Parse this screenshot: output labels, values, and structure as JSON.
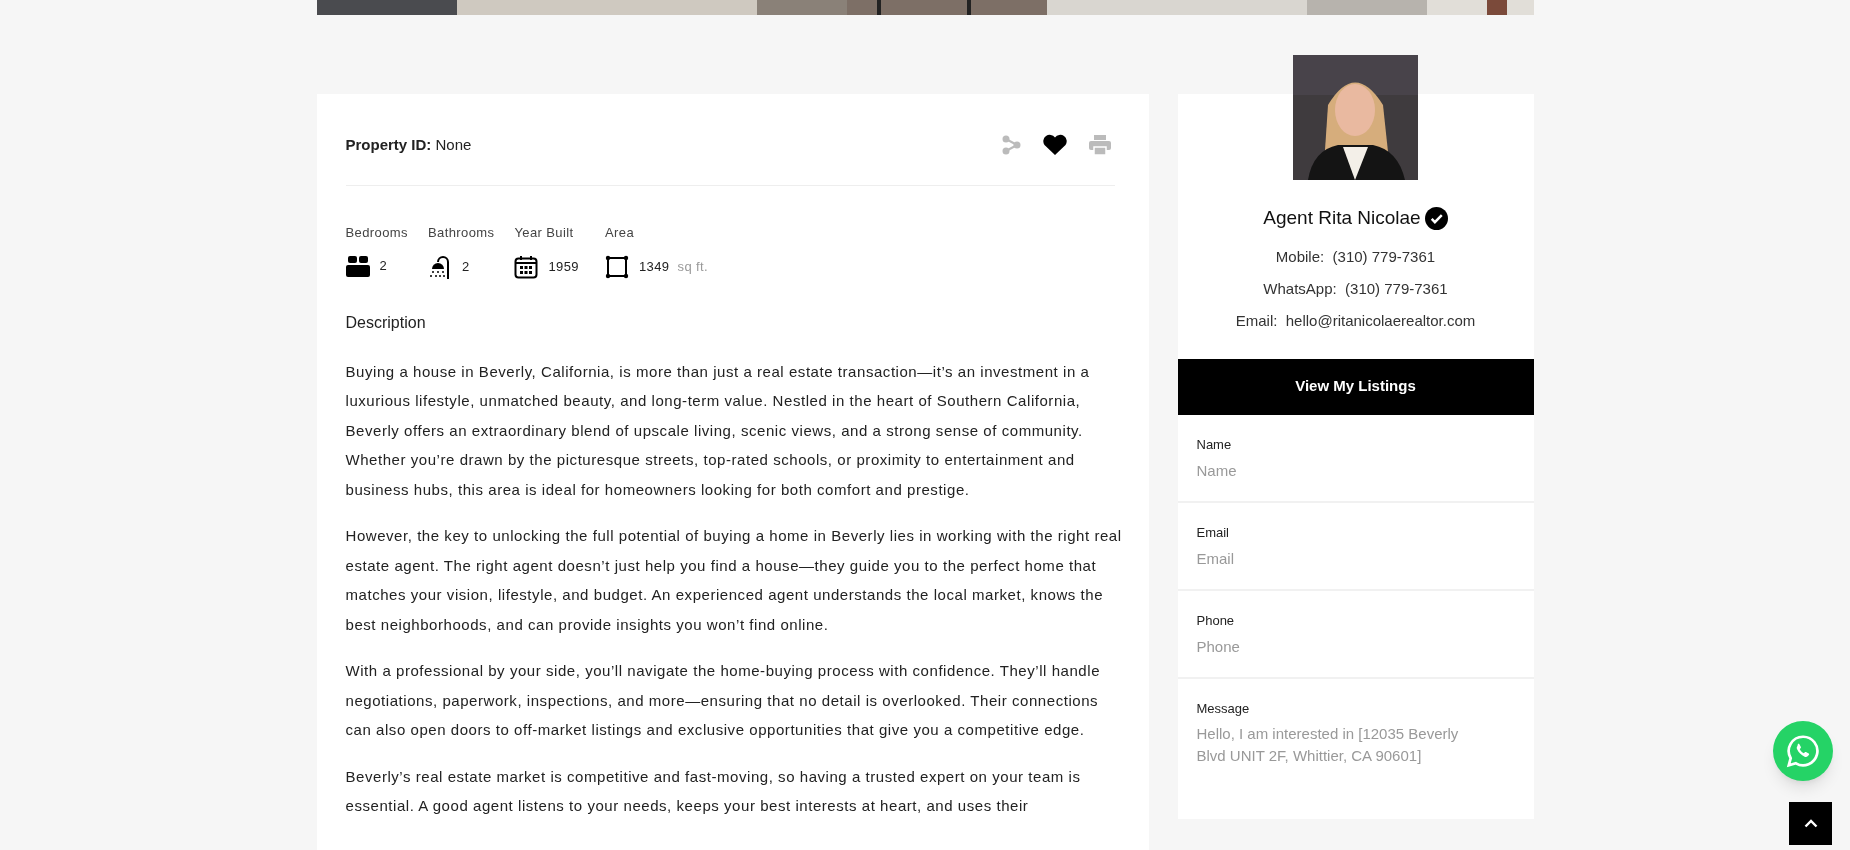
{
  "property": {
    "id_label": "Property ID:",
    "id_value": "None"
  },
  "actions": [
    {
      "kind": "share"
    },
    {
      "kind": "favorite"
    },
    {
      "kind": "print"
    }
  ],
  "facts": [
    {
      "kind": "bed",
      "label": "Bedrooms",
      "value": "2"
    },
    {
      "kind": "bath",
      "label": "Bathrooms",
      "value": "2"
    },
    {
      "kind": "year",
      "label": "Year Built",
      "value": "1959"
    },
    {
      "kind": "area",
      "label": "Area",
      "value": "1349",
      "unit": "sq ft."
    }
  ],
  "description": {
    "title": "Description",
    "paragraphs": [
      "Buying a house in Beverly, California, is more than just a real estate transaction—it’s an investment in a luxurious lifestyle, unmatched beauty, and long-term value. Nestled in the heart of Southern California, Beverly offers an extraordinary blend of upscale living, scenic views, and a strong sense of community. Whether you’re drawn by the picturesque streets, top-rated schools, or proximity to entertainment and business hubs, this area is ideal for homeowners looking for both comfort and prestige.",
      "However, the key to unlocking the full potential of buying a home in Beverly lies in working with the right real estate agent. The right agent doesn’t just help you find a house—they guide you to the perfect home that matches your vision, lifestyle, and budget. An experienced agent understands the local market, knows the best neighborhoods, and can provide insights you won’t find online.",
      "With a professional by your side, you’ll navigate the home-buying process with confidence. They’ll handle negotiations, paperwork, inspections, and more—ensuring that no detail is overlooked. Their connections can also open doors to off-market listings and exclusive opportunities that give you a competitive edge.",
      "Beverly’s real estate market is competitive and fast-moving, so having a trusted expert on your team is essential. A good agent listens to your needs, keeps your best interests at heart, and uses their"
    ]
  },
  "agent": {
    "name": "Agent Rita Nicolae",
    "verified": true,
    "contacts": [
      {
        "label": "Mobile:",
        "value": "(310) 779-7361"
      },
      {
        "label": "WhatsApp:",
        "value": "(310) 779-7361"
      },
      {
        "label": "Email:",
        "value": "hello@ritanicolaerealtor.com"
      }
    ],
    "button": "View My Listings"
  },
  "form": {
    "fields": [
      {
        "kind": "input",
        "label": "Name",
        "placeholder": "Name"
      },
      {
        "kind": "input",
        "label": "Email",
        "placeholder": "Email"
      },
      {
        "kind": "input",
        "label": "Phone",
        "placeholder": "Phone"
      },
      {
        "kind": "textarea",
        "label": "Message",
        "placeholder": "Hello, I am interested in [12035 Beverly Blvd UNIT 2F, Whittier, CA 90601]"
      }
    ]
  }
}
